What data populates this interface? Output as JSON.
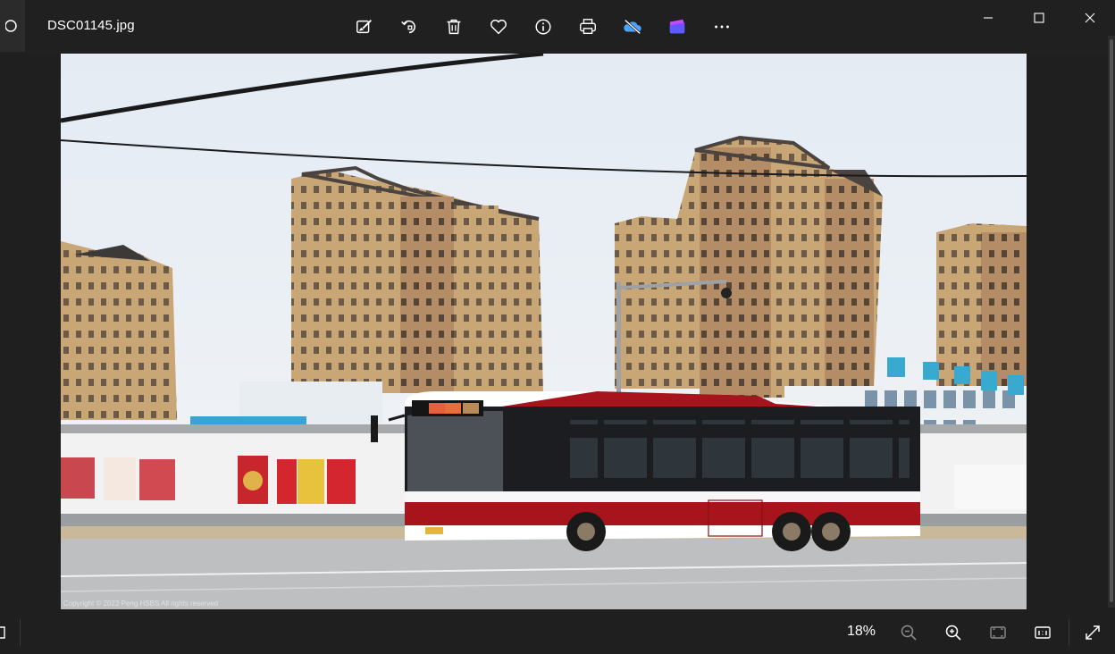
{
  "app": {
    "filename": "DSC01145.jpg"
  },
  "toolbar": {
    "edit": "edit-icon",
    "rotate": "rotate-icon",
    "delete": "trash-icon",
    "favorite": "heart-icon",
    "info": "info-icon",
    "print": "printer-icon",
    "onedrive": "cloud-off-icon",
    "clipchamp": "clipchamp-icon",
    "more": "more-icon"
  },
  "window": {
    "minimize": "minimize-icon",
    "maximize": "maximize-icon",
    "close": "close-icon"
  },
  "photo": {
    "watermark": "Copyright © 2023 Peng HSBS All rights reserved"
  },
  "status": {
    "zoom": "18%"
  },
  "colors": {
    "bg": "#1f1f1f",
    "sky": "#e9eef4",
    "bus_red": "#a7141b",
    "building": "#c6a57a"
  }
}
